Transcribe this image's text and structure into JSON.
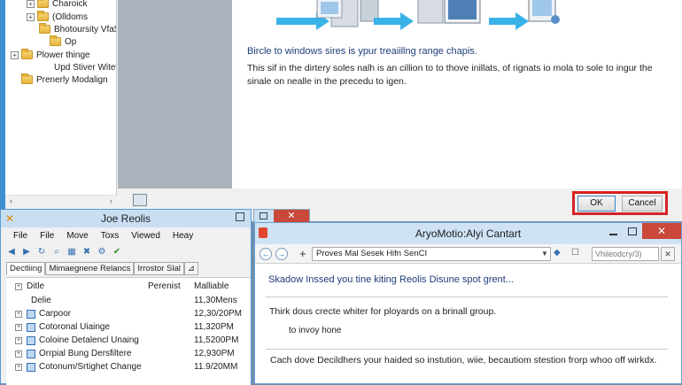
{
  "wizard": {
    "tree": {
      "items": [
        {
          "label": "Charoick",
          "toggle": "+",
          "folder": true
        },
        {
          "label": "(Olldoms",
          "toggle": "+",
          "folder": true
        },
        {
          "label": "Bhotoursity Vfa$)",
          "toggle": "",
          "folder": true
        },
        {
          "label": "Op",
          "toggle": "",
          "folder": true
        },
        {
          "label": "Plower thinge",
          "toggle": "+",
          "folder": true
        },
        {
          "label": "Upd Stiver Witew",
          "toggle": "",
          "folder": false
        },
        {
          "label": "Prenerly Modalign",
          "toggle": "",
          "folder": true
        }
      ],
      "toggle_symbol": "+",
      "scroll_left": "‹",
      "scroll_right": "›"
    },
    "content_heading": "Bircle to windows sires is ypur treaiillng range chapis.",
    "content_body": "This sif in the dirtery soles nalh is an cillion to to thove inillats, of rignats io mola to sole to ingur the sinale on nealle in the precedu to igen.",
    "ok_label": "OK",
    "cancel_label": "Cancel"
  },
  "explorer": {
    "title": "Joe Reolis",
    "app_icon": "✕",
    "menu": [
      "File",
      "File",
      "Move",
      "Toxs",
      "Viewed",
      "Heay"
    ],
    "tabs": [
      "Dectliing",
      "Mimaegnene Relancs",
      "Irrostor Slal"
    ],
    "tab_close": "⊿",
    "columns": {
      "name": "Ditle",
      "perenist": "Perenist",
      "mallable": "Malliable"
    },
    "header_toggle": "+",
    "rows": [
      {
        "name": "Delie",
        "value": "11,30Mens",
        "has_toggle": false
      },
      {
        "name": "Carpoor",
        "value": "12,30/20PM",
        "has_toggle": true
      },
      {
        "name": "Cotoronal Uiainge",
        "value": "11,320PM",
        "has_toggle": true
      },
      {
        "name": "Coloine Detalencl Unaing",
        "value": "11,5200PM",
        "has_toggle": true
      },
      {
        "name": "Orrpial Bung Dersfiltere",
        "value": "12,930PM",
        "has_toggle": true
      },
      {
        "name": "Cotonum/Srtighet Change",
        "value": "11.9/20MM",
        "has_toggle": true
      }
    ],
    "row_toggle_symbol": "+"
  },
  "float_window": {
    "close_symbol": "✕"
  },
  "browser": {
    "title": "AryoMotio:Alyi Cantart",
    "close_symbol": "✕",
    "back_symbol": "←",
    "forward_symbol": "→",
    "plus_symbol": "+",
    "address": "Proves Mal Sesek Hifn SenCI",
    "address_dropdown": "▼",
    "info_symbol": "◆",
    "fav_symbol": "☐",
    "search_placeholder": "Vhileodcry/3)",
    "search_symbol": "✕",
    "heading": "Skadow Inssed you tine kiting Reolis Disune spot grent...",
    "line1": "Thirk dous crecte whiter for ployards on a brinall group.",
    "line2": "to invoy hone",
    "footer": "Cach dove Decildhers your haided so instution, wiie, becautiom stestion frorp whoo off wirkdx."
  },
  "colors": {
    "accent_blue": "#3d8fd1",
    "close_red": "#c9483a",
    "highlight_red": "#d42424",
    "heading_blue": "#1e3c78"
  }
}
